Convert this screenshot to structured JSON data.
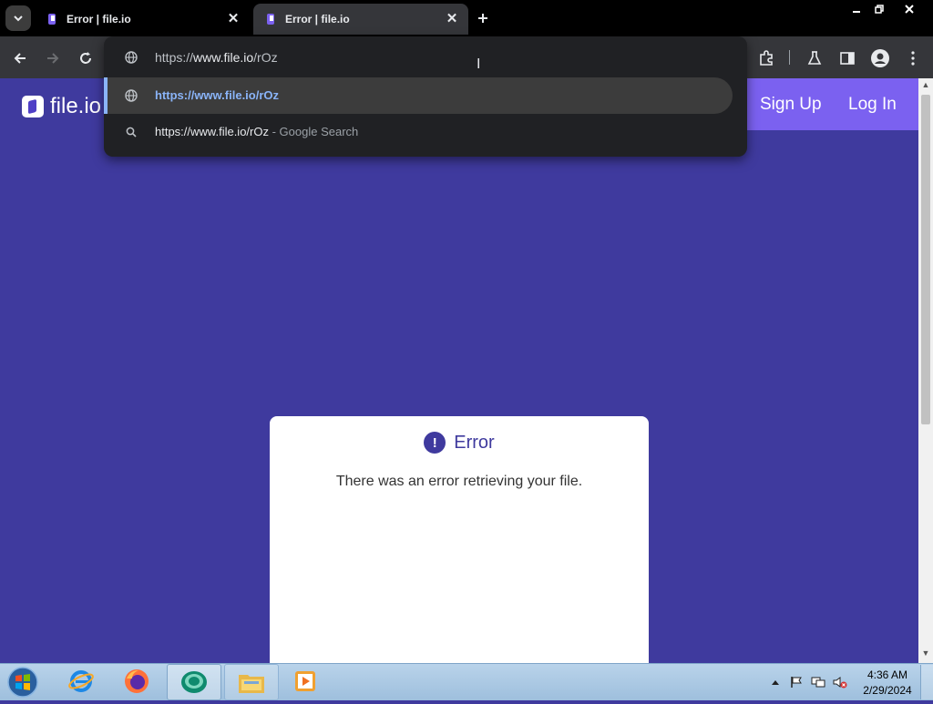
{
  "browser": {
    "tabs": [
      {
        "title": "Error | file.io",
        "active": false
      },
      {
        "title": "Error | file.io",
        "active": true
      }
    ],
    "omnibox": {
      "input_prefix": "https://",
      "input_domain": "www.file.io",
      "input_path": "/rOz",
      "suggestions": [
        {
          "text": "https://www.file.io/rOz",
          "icon": "globe-icon"
        },
        {
          "text": "https://www.file.io/rOz",
          "suffix": " - Google Search",
          "icon": "search-icon"
        }
      ]
    }
  },
  "site": {
    "logo_text": "file.io",
    "nav": {
      "signup": "Sign Up",
      "login": "Log In"
    },
    "error": {
      "title": "Error",
      "icon_glyph": "!",
      "message": "There was an error retrieving your file."
    }
  },
  "taskbar": {
    "apps": [
      "start-button",
      "internet-explorer",
      "firefox",
      "chrome-like-app",
      "file-explorer",
      "media-player"
    ],
    "clock": {
      "time": "4:36 AM",
      "date": "2/29/2024"
    }
  },
  "colors": {
    "page_bg": "#3f3a9e",
    "header_strip": "#7b61f0",
    "accent_link": "#8ab4f8"
  }
}
